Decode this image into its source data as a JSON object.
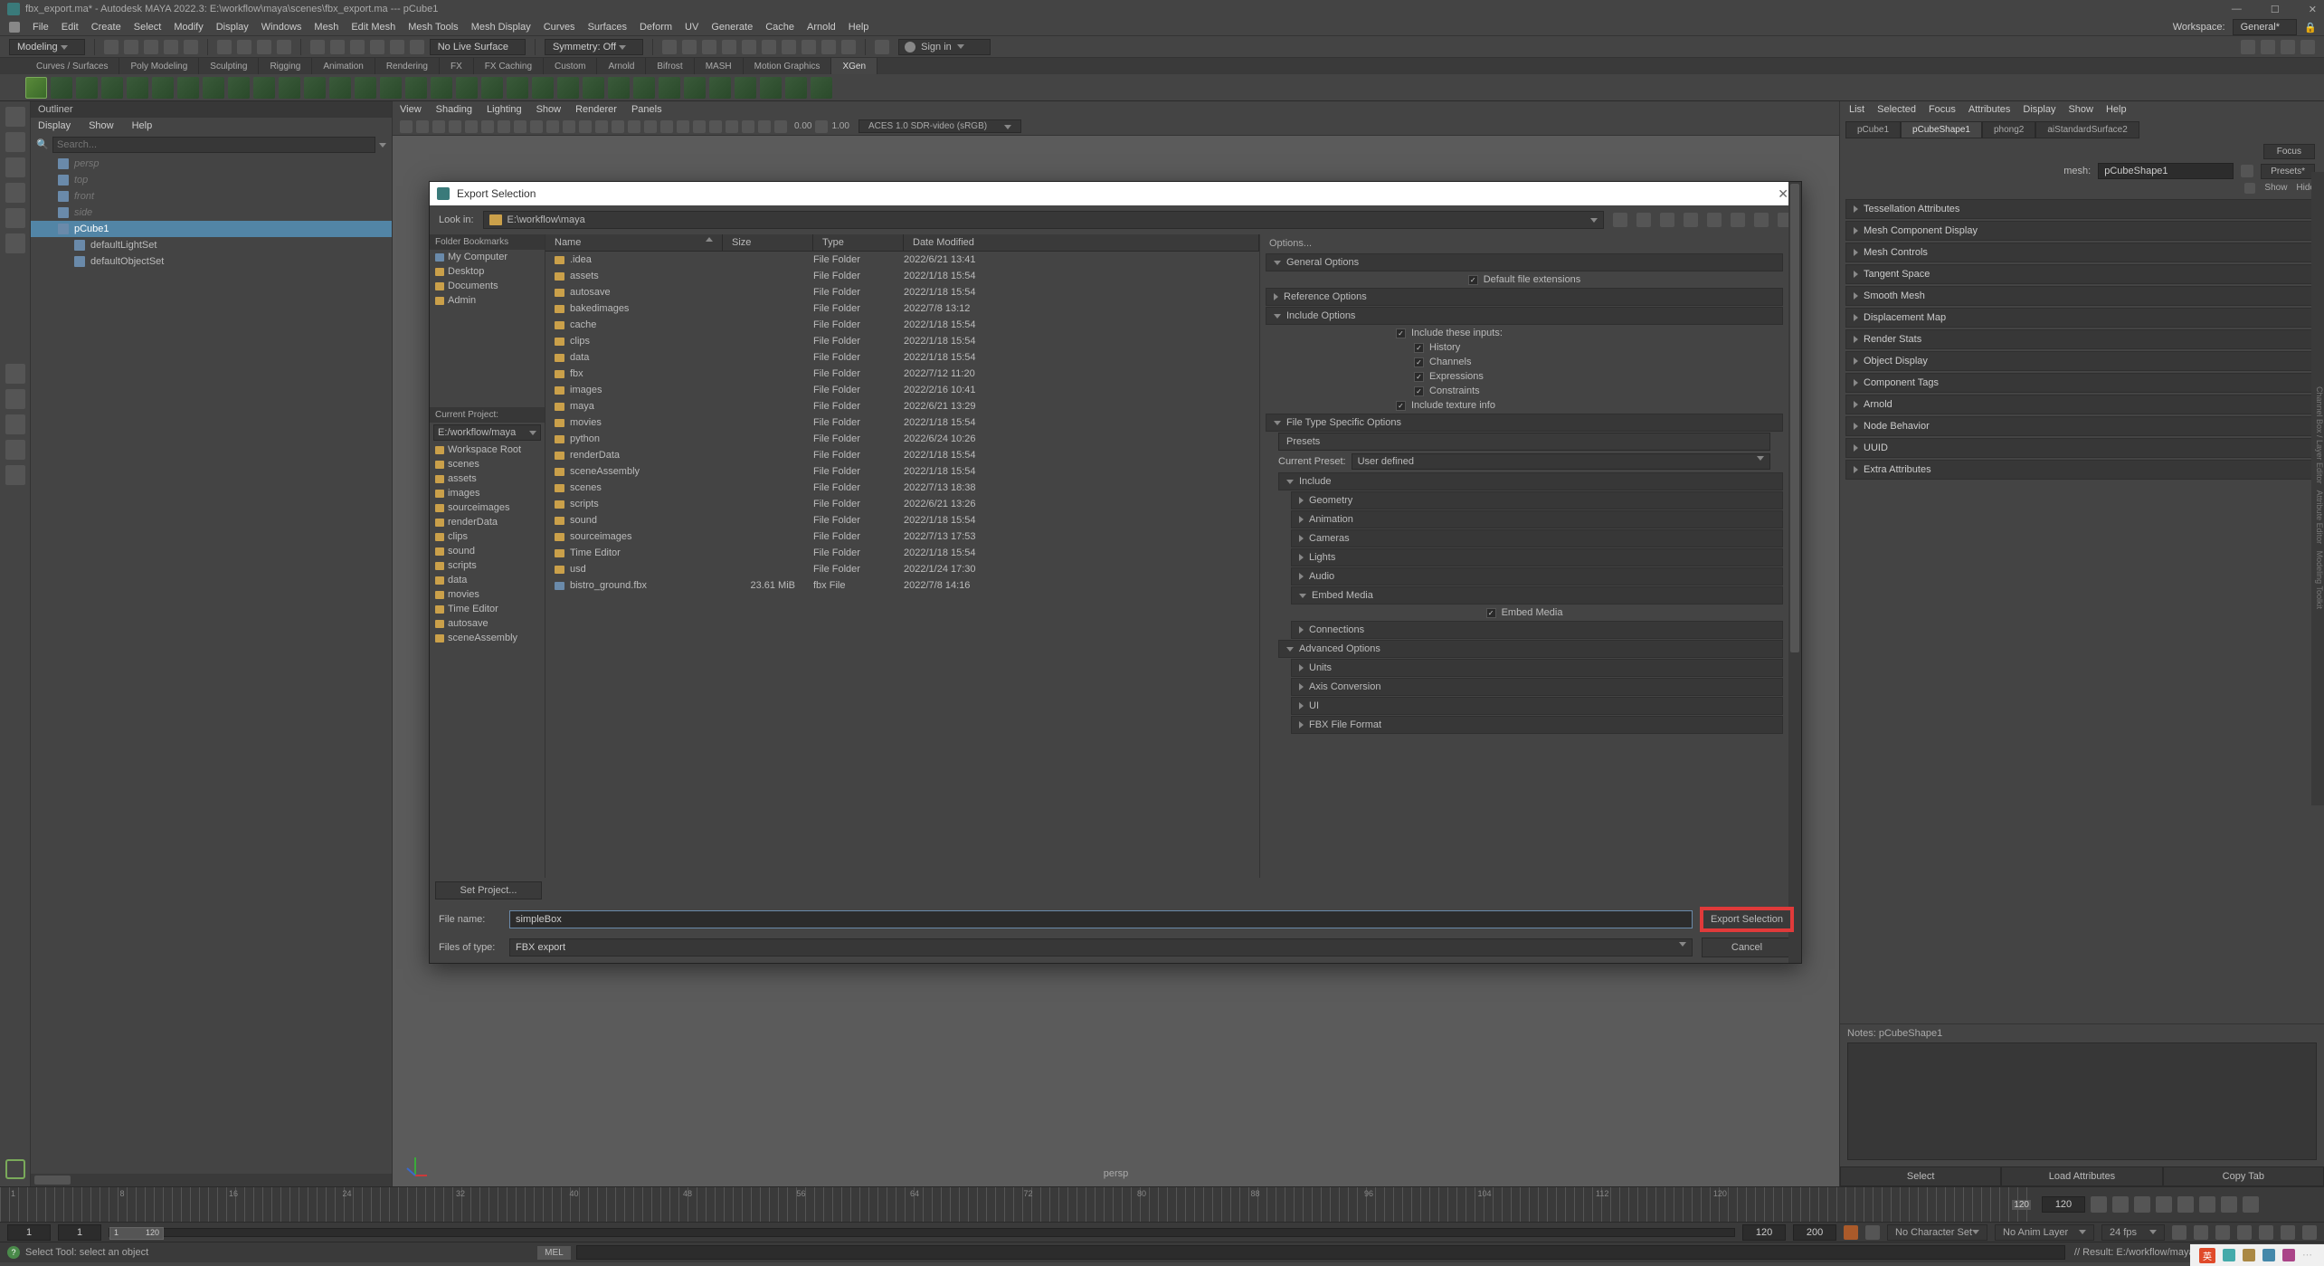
{
  "window": {
    "title": "fbx_export.ma* - Autodesk MAYA 2022.3: E:\\workflow\\maya\\scenes\\fbx_export.ma  ---  pCube1"
  },
  "menu": {
    "items": [
      "File",
      "Edit",
      "Create",
      "Select",
      "Modify",
      "Display",
      "Windows",
      "Mesh",
      "Edit Mesh",
      "Mesh Tools",
      "Mesh Display",
      "Curves",
      "Surfaces",
      "Deform",
      "UV",
      "Generate",
      "Cache",
      "Arnold",
      "Help"
    ],
    "workspace_label": "Workspace:",
    "workspace_value": "General*"
  },
  "shelf": {
    "mode": "Modeling",
    "no_live_surface": "No Live Surface",
    "symmetry": "Symmetry: Off",
    "signin": "Sign in",
    "tabs": [
      "Curves / Surfaces",
      "Poly Modeling",
      "Sculpting",
      "Rigging",
      "Animation",
      "Rendering",
      "FX",
      "FX Caching",
      "Custom",
      "Arnold",
      "Bifrost",
      "MASH",
      "Motion Graphics",
      "XGen"
    ],
    "active_tab": "XGen"
  },
  "outliner": {
    "title": "Outliner",
    "menus": [
      "Display",
      "Show",
      "Help"
    ],
    "search_placeholder": "Search...",
    "items": [
      {
        "label": "persp",
        "dim": true
      },
      {
        "label": "top",
        "dim": true
      },
      {
        "label": "front",
        "dim": true
      },
      {
        "label": "side",
        "dim": true
      },
      {
        "label": "pCube1",
        "selected": true
      },
      {
        "label": "defaultLightSet",
        "indent": true
      },
      {
        "label": "defaultObjectSet",
        "indent": true
      }
    ]
  },
  "viewport": {
    "menus": [
      "View",
      "Shading",
      "Lighting",
      "Show",
      "Renderer",
      "Panels"
    ],
    "val1": "0.00",
    "val2": "1.00",
    "colorspace": "ACES 1.0 SDR-video (sRGB)",
    "label": "persp"
  },
  "attr": {
    "menus": [
      "List",
      "Selected",
      "Focus",
      "Attributes",
      "Display",
      "Show",
      "Help"
    ],
    "tabs": [
      "pCube1",
      "pCubeShape1",
      "phong2",
      "aiStandardSurface2"
    ],
    "active_tab": "pCubeShape1",
    "focus": "Focus",
    "presets": "Presets*",
    "show": "Show",
    "hide": "Hide",
    "mesh_label": "mesh:",
    "mesh_value": "pCubeShape1",
    "sections": [
      "Tessellation Attributes",
      "Mesh Component Display",
      "Mesh Controls",
      "Tangent Space",
      "Smooth Mesh",
      "Displacement Map",
      "Render Stats",
      "Object Display",
      "Component Tags",
      "Arnold",
      "Node Behavior",
      "UUID",
      "Extra Attributes"
    ],
    "notes_label": "Notes: pCubeShape1",
    "buttons": [
      "Select",
      "Load Attributes",
      "Copy Tab"
    ]
  },
  "dialog": {
    "title": "Export Selection",
    "lookin_label": "Look in:",
    "lookin_path": "E:\\workflow\\maya",
    "bookmarks_header": "Folder Bookmarks",
    "bookmarks": [
      "My Computer",
      "Desktop",
      "Documents",
      "Admin"
    ],
    "curproj_header": "Current Project:",
    "curproj_value": "E:/workflow/maya",
    "project_items": [
      "Workspace Root",
      "scenes",
      "assets",
      "images",
      "sourceimages",
      "renderData",
      "clips",
      "sound",
      "scripts",
      "data",
      "movies",
      "Time Editor",
      "autosave",
      "sceneAssembly"
    ],
    "set_project": "Set Project...",
    "columns": {
      "name": "Name",
      "size": "Size",
      "type": "Type",
      "date": "Date Modified"
    },
    "files": [
      {
        "name": ".idea",
        "size": "",
        "type": "File Folder",
        "date": "2022/6/21 13:41"
      },
      {
        "name": "assets",
        "size": "",
        "type": "File Folder",
        "date": "2022/1/18 15:54"
      },
      {
        "name": "autosave",
        "size": "",
        "type": "File Folder",
        "date": "2022/1/18 15:54"
      },
      {
        "name": "bakedimages",
        "size": "",
        "type": "File Folder",
        "date": "2022/7/8 13:12"
      },
      {
        "name": "cache",
        "size": "",
        "type": "File Folder",
        "date": "2022/1/18 15:54"
      },
      {
        "name": "clips",
        "size": "",
        "type": "File Folder",
        "date": "2022/1/18 15:54"
      },
      {
        "name": "data",
        "size": "",
        "type": "File Folder",
        "date": "2022/1/18 15:54"
      },
      {
        "name": "fbx",
        "size": "",
        "type": "File Folder",
        "date": "2022/7/12 11:20"
      },
      {
        "name": "images",
        "size": "",
        "type": "File Folder",
        "date": "2022/2/16 10:41"
      },
      {
        "name": "maya",
        "size": "",
        "type": "File Folder",
        "date": "2022/6/21 13:29"
      },
      {
        "name": "movies",
        "size": "",
        "type": "File Folder",
        "date": "2022/1/18 15:54"
      },
      {
        "name": "python",
        "size": "",
        "type": "File Folder",
        "date": "2022/6/24 10:26"
      },
      {
        "name": "renderData",
        "size": "",
        "type": "File Folder",
        "date": "2022/1/18 15:54"
      },
      {
        "name": "sceneAssembly",
        "size": "",
        "type": "File Folder",
        "date": "2022/1/18 15:54"
      },
      {
        "name": "scenes",
        "size": "",
        "type": "File Folder",
        "date": "2022/7/13 18:38"
      },
      {
        "name": "scripts",
        "size": "",
        "type": "File Folder",
        "date": "2022/6/21 13:26"
      },
      {
        "name": "sound",
        "size": "",
        "type": "File Folder",
        "date": "2022/1/18 15:54"
      },
      {
        "name": "sourceimages",
        "size": "",
        "type": "File Folder",
        "date": "2022/7/13 17:53"
      },
      {
        "name": "Time Editor",
        "size": "",
        "type": "File Folder",
        "date": "2022/1/18 15:54"
      },
      {
        "name": "usd",
        "size": "",
        "type": "File Folder",
        "date": "2022/1/24 17:30"
      },
      {
        "name": "bistro_ground.fbx",
        "size": "23.61 MiB",
        "type": "fbx File",
        "date": "2022/7/8 14:16",
        "file": true
      }
    ],
    "options": {
      "header": "Options...",
      "general": "General Options",
      "default_ext": "Default file extensions",
      "reference": "Reference Options",
      "include": "Include Options",
      "include_inputs": "Include these inputs:",
      "history": "History",
      "channels": "Channels",
      "expressions": "Expressions",
      "constraints": "Constraints",
      "include_texture": "Include texture info",
      "filetype": "File Type Specific Options",
      "presets": "Presets",
      "current_preset_label": "Current Preset:",
      "current_preset_value": "User defined",
      "sec_include": "Include",
      "geometry": "Geometry",
      "animation": "Animation",
      "cameras": "Cameras",
      "lights": "Lights",
      "audio": "Audio",
      "embed_media": "Embed Media",
      "embed_media_chk": "Embed Media",
      "connections": "Connections",
      "advanced": "Advanced Options",
      "units": "Units",
      "axis": "Axis Conversion",
      "ui": "UI",
      "fbxfile": "FBX File Format"
    },
    "filename_label": "File name:",
    "filename_value": "simpleBox",
    "filetype_label": "Files of type:",
    "filetype_value": "FBX export",
    "export_btn": "Export Selection",
    "cancel_btn": "Cancel"
  },
  "timeline": {
    "current": "120",
    "start1": "1",
    "start2": "1",
    "inner_start": "1",
    "inner_end": "120",
    "end1": "120",
    "end2": "200",
    "tick_labels": [
      "1",
      "8",
      "16",
      "24",
      "32",
      "40",
      "48",
      "56",
      "64",
      "72",
      "80",
      "88",
      "96",
      "104",
      "112",
      "120"
    ],
    "no_char": "No Character Set",
    "no_anim": "No Anim Layer",
    "fps": "24 fps"
  },
  "status": {
    "hint": "Select Tool: select an object",
    "cmd_label": "MEL",
    "result": "// Result: E:/workflow/maya/scenes/simpleBox.fbx"
  },
  "tray": {
    "ime": "英"
  }
}
